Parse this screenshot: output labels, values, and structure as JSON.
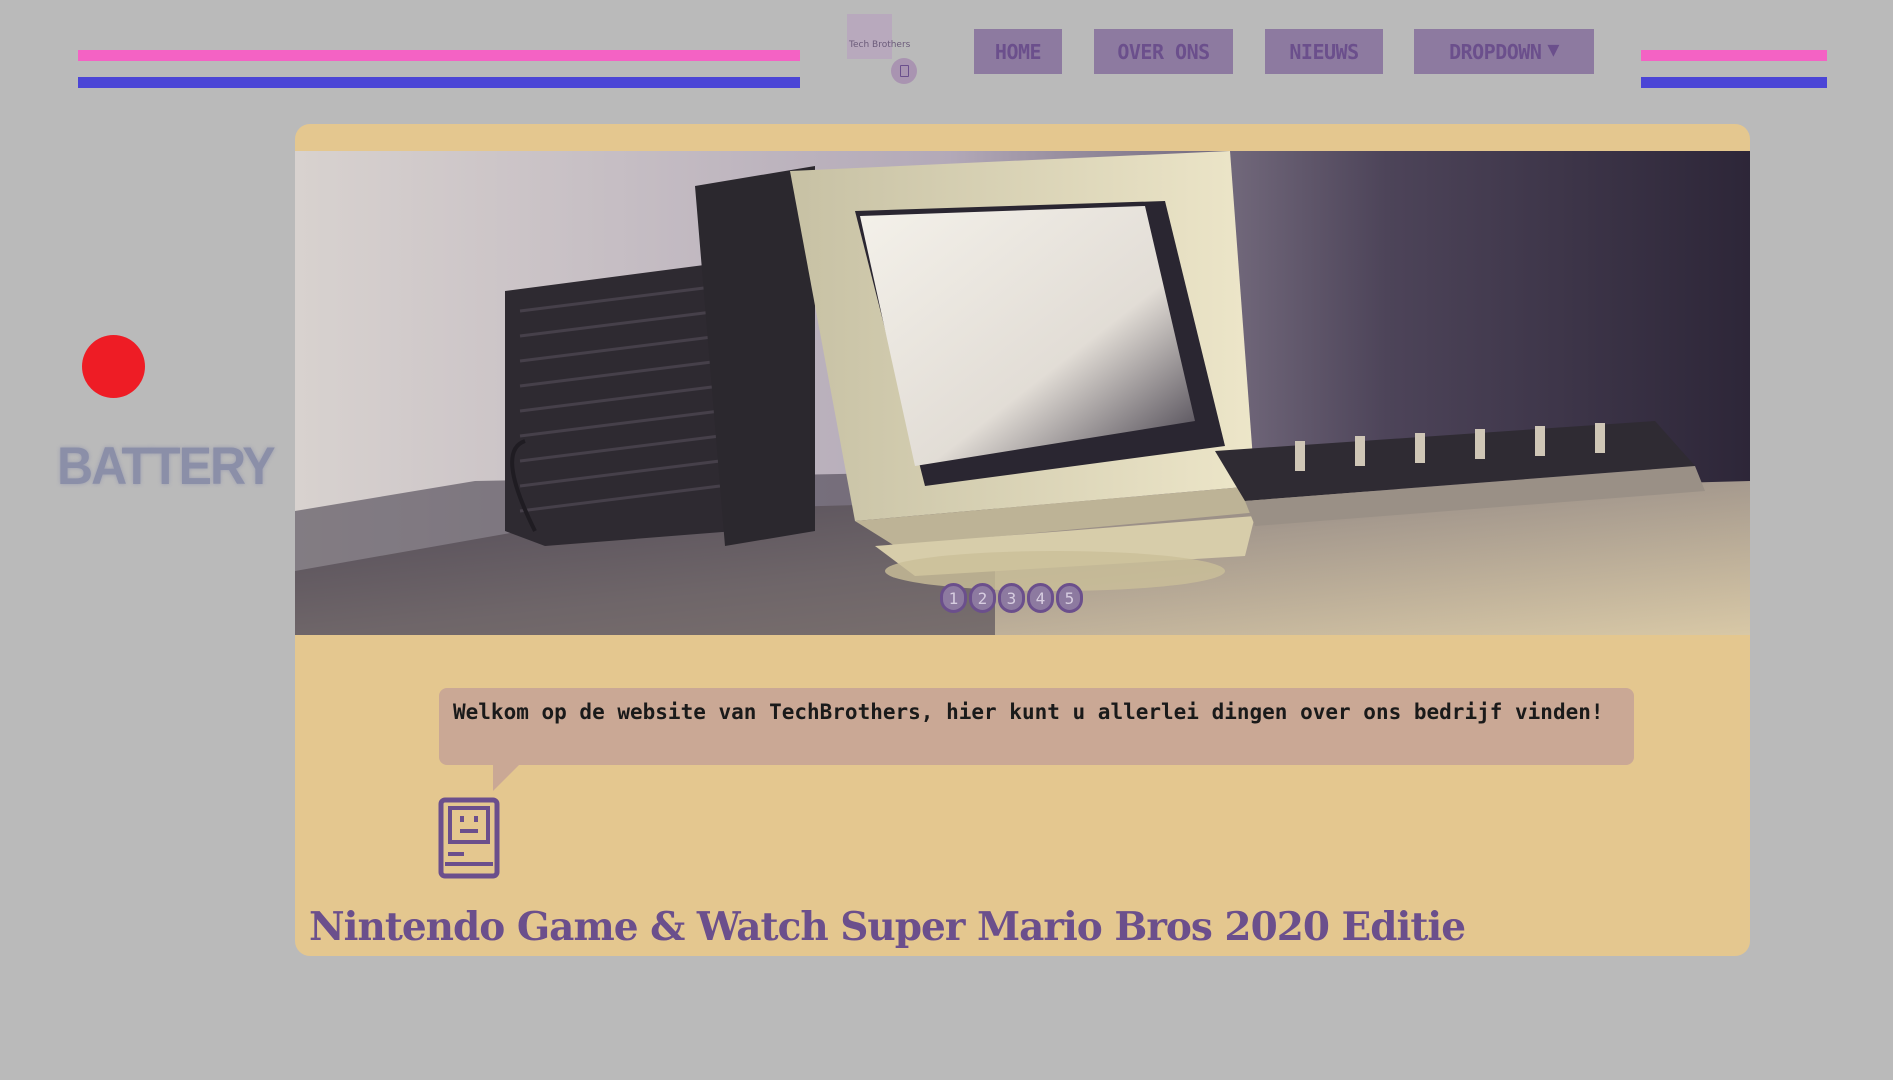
{
  "header": {
    "logo_text": "Tech Brothers",
    "nav": [
      {
        "label": "Home"
      },
      {
        "label": "Over ons"
      },
      {
        "label": "Nieuws"
      },
      {
        "label": "Dropdown"
      }
    ],
    "dropdown_icon": "triangle-down-icon"
  },
  "sidebar": {
    "status_label": "BATTERY",
    "status_color": "#ee1c25"
  },
  "carousel": {
    "image_alt": "retro computer",
    "slides": [
      "1",
      "2",
      "3",
      "4",
      "5"
    ]
  },
  "welcome": {
    "message": "Welkom op de website van TechBrothers, hier kunt u allerlei dingen over ons bedrijf vinden!",
    "icon": "mac-icon"
  },
  "product": {
    "title": "Nintendo Game & Watch Super Mario Bros 2020 Editie"
  },
  "colors": {
    "background": "#bababa",
    "card": "#e4c78f",
    "accent_pink": "#f462c4",
    "accent_blue": "#4b45d6",
    "nav_bg": "#8d7aa0",
    "purple": "#6b4f8c"
  }
}
